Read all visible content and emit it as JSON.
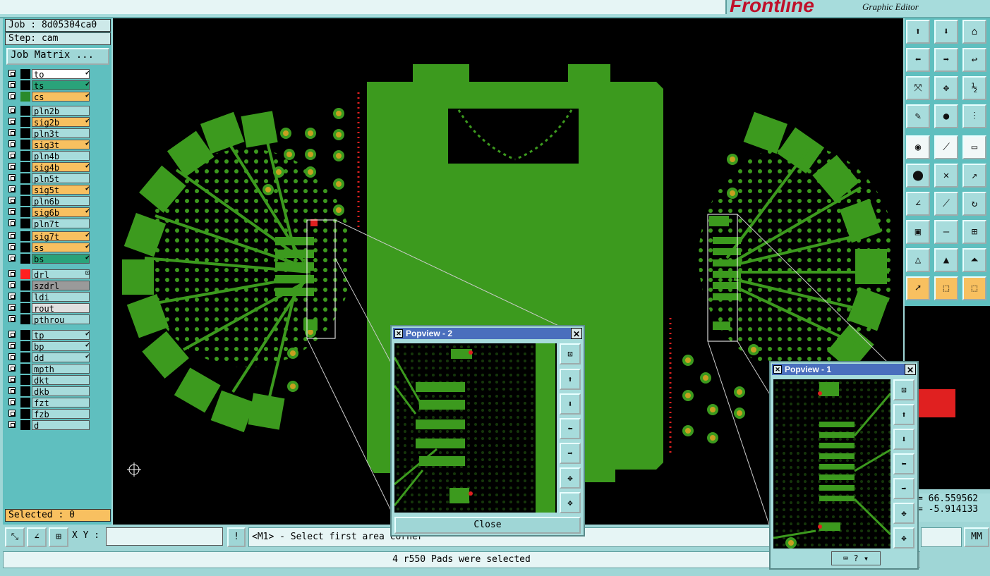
{
  "app": {
    "logo_text": "Frontline",
    "subtitle": "Graphic Editor"
  },
  "job": {
    "job_label": "Job : 8d05304ca0",
    "step_label": "Step: cam",
    "matrix_button": "Job Matrix ..."
  },
  "layers": [
    {
      "name": "to",
      "bg": "#ffffff",
      "swatch": "#000000",
      "mark": "✔"
    },
    {
      "name": "ts",
      "bg": "#2aa37a",
      "swatch": "#000000",
      "mark": "✔"
    },
    {
      "name": "cs",
      "bg": "#f8c060",
      "swatch": "#2a8a2a",
      "mark": "✔"
    },
    {
      "name": "pln2b",
      "bg": "#a7dcdc",
      "swatch": "#000000",
      "mark": ""
    },
    {
      "name": "sig2b",
      "bg": "#f8c060",
      "swatch": "#000000",
      "mark": "✔"
    },
    {
      "name": "pln3t",
      "bg": "#a7dcdc",
      "swatch": "#000000",
      "mark": ""
    },
    {
      "name": "sig3t",
      "bg": "#f8c060",
      "swatch": "#000000",
      "mark": "✔"
    },
    {
      "name": "pln4b",
      "bg": "#a7dcdc",
      "swatch": "#000000",
      "mark": ""
    },
    {
      "name": "sig4b",
      "bg": "#f8c060",
      "swatch": "#000000",
      "mark": "✔"
    },
    {
      "name": "pln5t",
      "bg": "#a7dcdc",
      "swatch": "#000000",
      "mark": ""
    },
    {
      "name": "sig5t",
      "bg": "#f8c060",
      "swatch": "#000000",
      "mark": "✔"
    },
    {
      "name": "pln6b",
      "bg": "#a7dcdc",
      "swatch": "#000000",
      "mark": ""
    },
    {
      "name": "sig6b",
      "bg": "#f8c060",
      "swatch": "#000000",
      "mark": "✔"
    },
    {
      "name": "pln7t",
      "bg": "#a7dcdc",
      "swatch": "#000000",
      "mark": ""
    },
    {
      "name": "sig7t",
      "bg": "#f8c060",
      "swatch": "#000000",
      "mark": "✔"
    },
    {
      "name": "ss",
      "bg": "#f8c060",
      "swatch": "#000000",
      "mark": "✔"
    },
    {
      "name": "bs",
      "bg": "#2aa37a",
      "swatch": "#000000",
      "mark": "✔"
    },
    {
      "name": "drl",
      "bg": "#a7dcdc",
      "swatch": "#ff2020",
      "mark": "⊡"
    },
    {
      "name": "szdrl",
      "bg": "#9a9a9a",
      "swatch": "#000000",
      "mark": ""
    },
    {
      "name": "ldi",
      "bg": "#a7dcdc",
      "swatch": "#000000",
      "mark": ""
    },
    {
      "name": "rout",
      "bg": "#e0e0e0",
      "swatch": "#000000",
      "mark": ""
    },
    {
      "name": "pthrou",
      "bg": "#a7dcdc",
      "swatch": "#000000",
      "mark": ""
    },
    {
      "name": "tp",
      "bg": "#a7dcdc",
      "swatch": "#000000",
      "mark": "✔"
    },
    {
      "name": "bp",
      "bg": "#a7dcdc",
      "swatch": "#000000",
      "mark": "✔"
    },
    {
      "name": "dd",
      "bg": "#a7dcdc",
      "swatch": "#000000",
      "mark": "✔"
    },
    {
      "name": "mpth",
      "bg": "#a7dcdc",
      "swatch": "#000000",
      "mark": ""
    },
    {
      "name": "dkt",
      "bg": "#a7dcdc",
      "swatch": "#000000",
      "mark": ""
    },
    {
      "name": "dkb",
      "bg": "#a7dcdc",
      "swatch": "#000000",
      "mark": ""
    },
    {
      "name": "fzt",
      "bg": "#a7dcdc",
      "swatch": "#000000",
      "mark": ""
    },
    {
      "name": "fzb",
      "bg": "#a7dcdc",
      "swatch": "#000000",
      "mark": ""
    },
    {
      "name": "d",
      "bg": "#a7dcdc",
      "swatch": "#000000",
      "mark": ""
    }
  ],
  "selected": "Selected : 0",
  "xy_label": "X Y :",
  "prompt": "<M1> - Select first area corner",
  "status": "4 r550 Pads were selected",
  "coords": {
    "x": "= 66.559562",
    "y": "= -5.914133"
  },
  "units": "MM",
  "popview2": {
    "title": "Popview - 2",
    "close_label": "Close"
  },
  "popview1": {
    "title": "Popview - 1"
  },
  "colors": {
    "copper": "#3c9a1e",
    "pad": "#c8a020",
    "canvas": "#000000"
  }
}
